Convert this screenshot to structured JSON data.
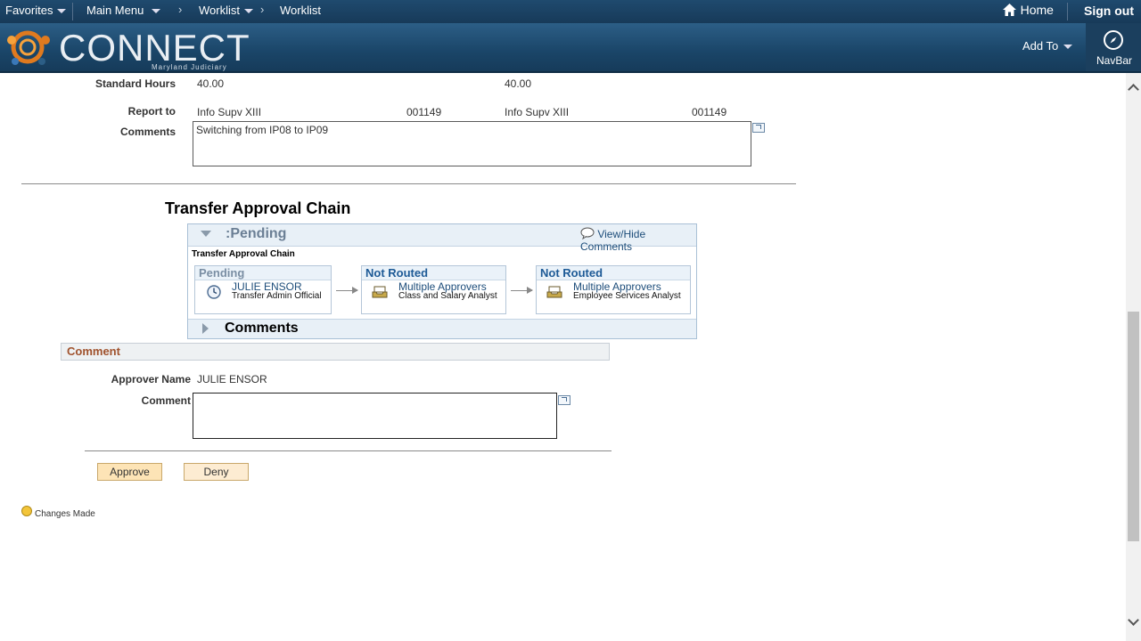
{
  "topnav": {
    "favorites": "Favorites",
    "main_menu": "Main Menu",
    "breadcrumb": [
      "Worklist",
      "Worklist"
    ],
    "home": "Home",
    "sign_out": "Sign out"
  },
  "banner": {
    "logo_text": "CONNECT",
    "logo_sub": "Maryland Judiciary",
    "add_to": "Add To",
    "navbar": "NavBar"
  },
  "details": {
    "standard_hours_label": "Standard Hours",
    "standard_hours_current": "40.00",
    "standard_hours_new": "40.00",
    "report_to_label": "Report to",
    "report_to_current": "Info Supv XIII",
    "report_to_current_id": "001149",
    "report_to_new": "Info Supv XIII",
    "report_to_new_id": "001149",
    "comments_label": "Comments",
    "comments_value": "Switching from IP08 to IP09"
  },
  "approval": {
    "section_title": "Transfer Approval Chain",
    "status": ":Pending",
    "view_hide": "View/Hide Comments",
    "chain_label": "Transfer Approval Chain",
    "stages": [
      {
        "status": "Pending",
        "name": "JULIE ENSOR",
        "role": "Transfer Admin Official",
        "icon": "clock-icon"
      },
      {
        "status": "Not Routed",
        "name": "Multiple Approvers",
        "role": "Class and Salary Analyst",
        "icon": "inbox-tray-icon"
      },
      {
        "status": "Not Routed",
        "name": "Multiple Approvers",
        "role": "Employee Services Analyst",
        "icon": "inbox-tray-icon"
      }
    ],
    "comments_label": "Comments"
  },
  "comment_section": {
    "header": "Comment",
    "approver_label": "Approver Name",
    "approver_value": "JULIE ENSOR",
    "comment_label": "Comment",
    "comment_value": ""
  },
  "actions": {
    "approve": "Approve",
    "deny": "Deny"
  },
  "footer": {
    "changes_made": "Changes Made"
  },
  "colors": {
    "nav_bg": "#173a59",
    "pending_color": "#7a8ea3",
    "not_routed_color": "#1d5a96",
    "comment_header_color": "#a0522d",
    "button_bg": "#fde4b6"
  }
}
